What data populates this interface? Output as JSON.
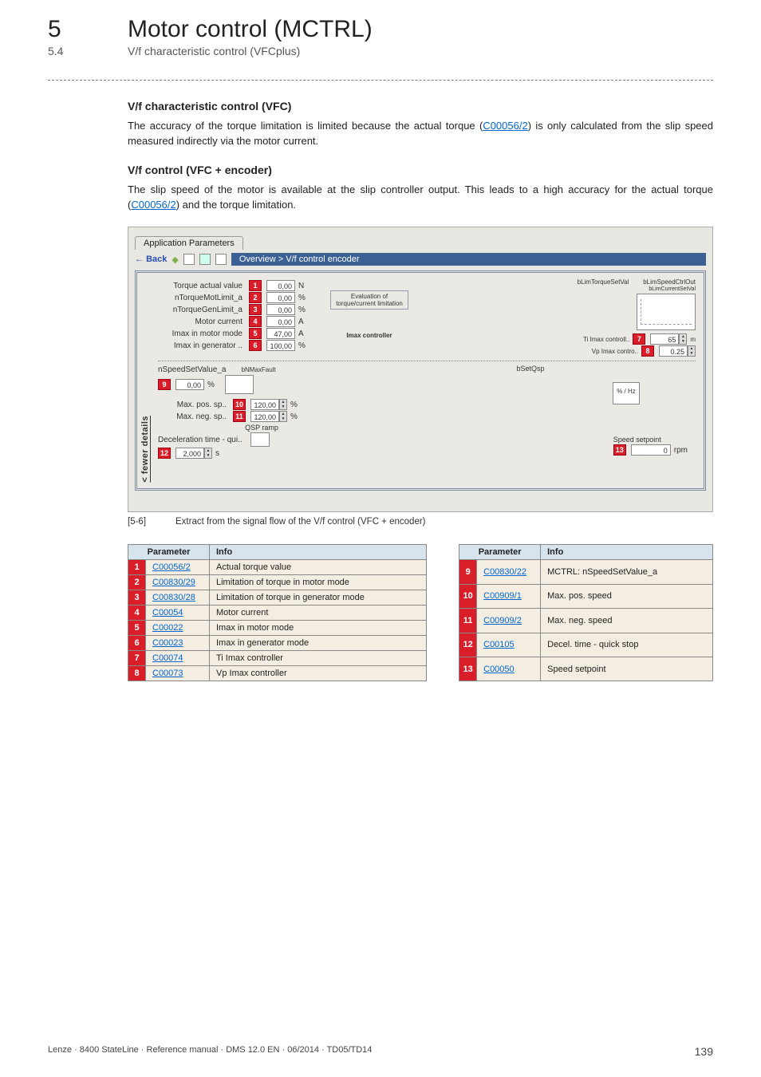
{
  "header": {
    "chapter_num": "5",
    "chapter_title": "Motor control (MCTRL)",
    "sub_num": "5.4",
    "sub_title": "V/f characteristic control (VFCplus)"
  },
  "sec1": {
    "heading": "V/f characteristic control (VFC)",
    "body_pre": "The accuracy of the torque limitation is limited because the actual torque (",
    "link": "C00056/2",
    "body_post": ") is only calculated from the slip speed measured indirectly via the motor current."
  },
  "sec2": {
    "heading": "V/f control (VFC + encoder)",
    "body_pre": "The slip speed of the motor is available at the slip controller output. This leads to a high accuracy for the actual torque (",
    "link": "C00056/2",
    "body_post": ") and the torque limitation."
  },
  "figure": {
    "tab": "Application Parameters",
    "back": "Back",
    "breadcrumb": "Overview > V/f control encoder",
    "rows": {
      "r1_label": "Torque actual value",
      "r1_val": "0,00",
      "r1_unit": "N",
      "r2_label": "nTorqueMotLimit_a",
      "r2_val": "0,00",
      "r2_unit": "%",
      "r3_label": "nTorqueGenLimit_a",
      "r3_val": "0,00",
      "r3_unit": "%",
      "r4_label": "Motor current",
      "r4_val": "0,00",
      "r4_unit": "A",
      "r5_label": "Imax in motor mode",
      "r5_val": "47,00",
      "r5_unit": "A",
      "r6_label": "Imax in generator ..",
      "r6_val": "100,00",
      "r6_unit": "%",
      "eval_label": "Evaluation of torque/current limitation",
      "r7_label": "Ti Imax controll..",
      "r7_val": "65",
      "r7_unit": "m",
      "r8_label": "Vp Imax contro..",
      "r8_val": "0.25",
      "imax_caption": "Imax controller",
      "sig1": "bLimTorqueSetVal",
      "sig2": "bLimSpeedCtrlOut",
      "sig3": "bLimCurrentSetVal",
      "r9_label": "nSpeedSetValue_a",
      "r9_val": "0,00",
      "r9_unit": "%",
      "bnmax": "bNMaxFault",
      "bsetq": "bSetQsp",
      "r10_label": "Max. pos. sp..",
      "r10_val": "120,00",
      "r10_unit": "%",
      "r11_label": "Max. neg. sp..",
      "r11_val": "120,00",
      "r11_unit": "%",
      "qsp": "QSP ramp",
      "r12_label": "Deceleration time - qui..",
      "r12_val": "2,000",
      "r12_unit": "s",
      "speed_setpoint": "Speed setpoint",
      "r13_val": "0",
      "r13_unit": "rpm",
      "pct_hz": "% / Hz"
    },
    "fewer": "< fewer details",
    "caption_tag": "[5-6]",
    "caption_text": "Extract from the signal flow of the V/f control (VFC + encoder)"
  },
  "tables": {
    "h_param": "Parameter",
    "h_info": "Info",
    "t1": [
      {
        "n": "1",
        "p": "C00056/2",
        "i": "Actual torque value"
      },
      {
        "n": "2",
        "p": "C00830/29",
        "i": "Limitation of torque in motor mode"
      },
      {
        "n": "3",
        "p": "C00830/28",
        "i": "Limitation of torque in generator mode"
      },
      {
        "n": "4",
        "p": "C00054",
        "i": "Motor current"
      },
      {
        "n": "5",
        "p": "C00022",
        "i": "Imax in motor mode"
      },
      {
        "n": "6",
        "p": "C00023",
        "i": "Imax in generator mode"
      },
      {
        "n": "7",
        "p": "C00074",
        "i": "Ti Imax controller"
      },
      {
        "n": "8",
        "p": "C00073",
        "i": "Vp Imax controller"
      }
    ],
    "t2": [
      {
        "n": "9",
        "p": "C00830/22",
        "i": "MCTRL: nSpeedSetValue_a"
      },
      {
        "n": "10",
        "p": "C00909/1",
        "i": "Max. pos. speed"
      },
      {
        "n": "11",
        "p": "C00909/2",
        "i": "Max. neg. speed"
      },
      {
        "n": "12",
        "p": "C00105",
        "i": "Decel. time - quick stop"
      },
      {
        "n": "13",
        "p": "C00050",
        "i": "Speed setpoint"
      }
    ]
  },
  "footer": {
    "left": "Lenze · 8400 StateLine · Reference manual · DMS 12.0 EN · 06/2014 · TD05/TD14",
    "page": "139"
  }
}
